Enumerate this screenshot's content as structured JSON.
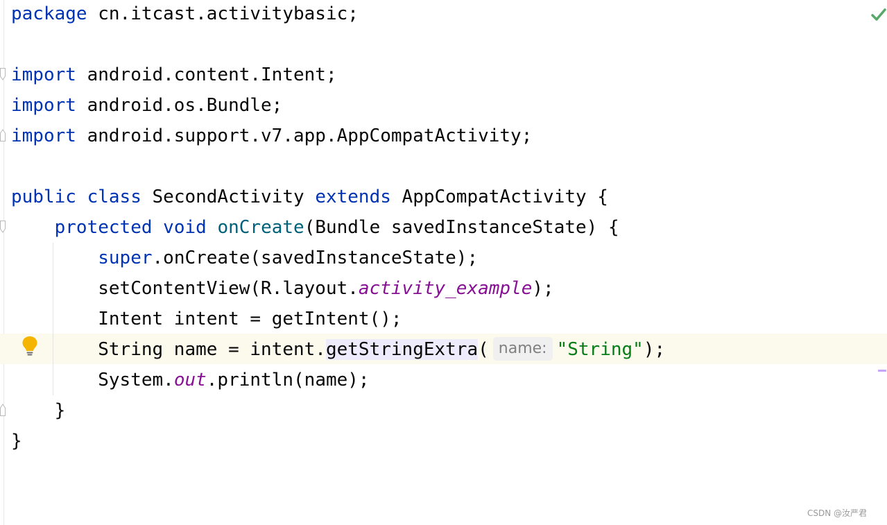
{
  "editor": {
    "lines": {
      "l1": {
        "kw": "package",
        "rest": " cn.itcast.activitybasic;"
      },
      "l3": {
        "kw": "import",
        "rest": " android.content.Intent;"
      },
      "l4": {
        "kw": "import",
        "rest": " android.os.Bundle;"
      },
      "l5": {
        "kw": "import",
        "rest": " android.support.v7.app.AppCompatActivity;"
      },
      "l7": {
        "kw1": "public",
        "kw2": "class",
        "name": " SecondActivity ",
        "kw3": "extends",
        "rest": " AppCompatActivity {"
      },
      "l8": {
        "kw1": "protected",
        "kw2": "void",
        "fn": "onCreate",
        "rest": "(Bundle savedInstanceState) {"
      },
      "l9": {
        "kw": "super",
        "rest": ".onCreate(savedInstanceState);"
      },
      "l10": {
        "pre": "setContentView(R.layout.",
        "const": "activity_example",
        "post": ");"
      },
      "l11": {
        "text": "Intent intent = getIntent();"
      },
      "l12": {
        "pre": "String name = intent.",
        "call": "getStringExtra",
        "paren": "(",
        "hint": "name:",
        "str": "\"String\"",
        "post": ");"
      },
      "l13": {
        "pre": "System.",
        "const": "out",
        "post": ".println(name);"
      },
      "l14": {
        "text": "}"
      },
      "l15": {
        "text": "}"
      }
    },
    "icons": {
      "bulb": "lightbulb-icon",
      "status": "check-icon"
    },
    "colors": {
      "keyword": "#0033b3",
      "function": "#00627a",
      "string": "#067d17",
      "constant": "#871094",
      "bulb": "#f5b400",
      "check": "#59a869"
    }
  },
  "watermark": "CSDN @汝严君"
}
